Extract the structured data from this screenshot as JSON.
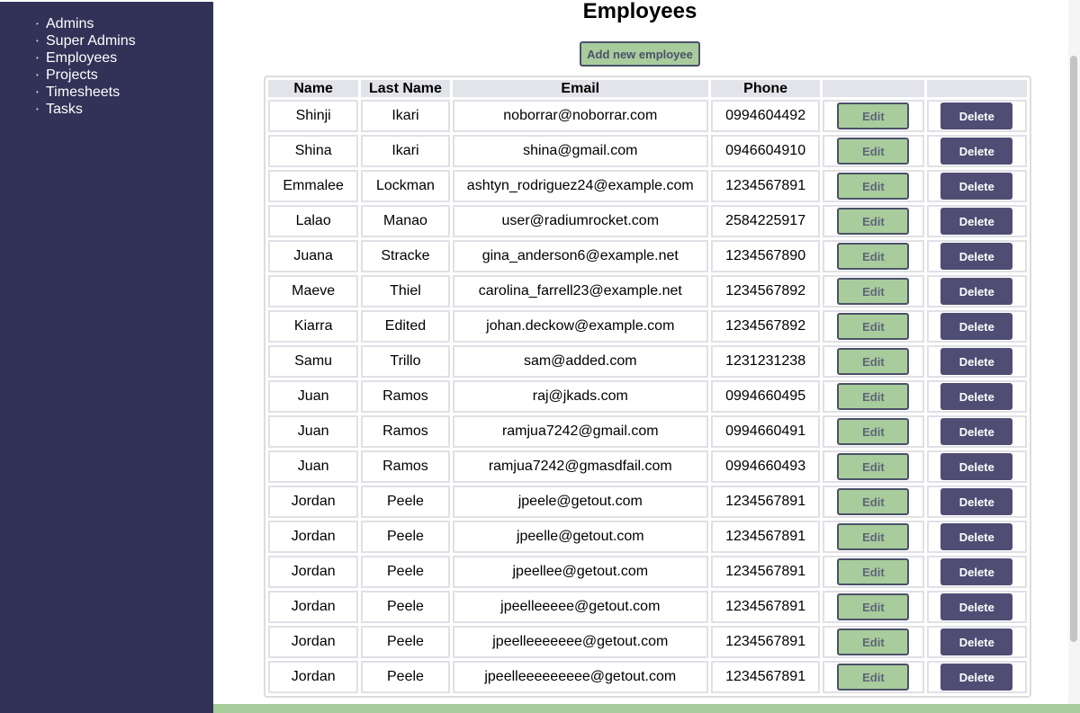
{
  "sidebar": {
    "items": [
      {
        "label": "Admins"
      },
      {
        "label": "Super Admins"
      },
      {
        "label": "Employees"
      },
      {
        "label": "Projects"
      },
      {
        "label": "Timesheets"
      },
      {
        "label": "Tasks"
      }
    ]
  },
  "main": {
    "title": "Employees",
    "add_label": "Add new employee"
  },
  "table": {
    "headers": {
      "name": "Name",
      "last_name": "Last Name",
      "email": "Email",
      "phone": "Phone"
    },
    "edit_label": "Edit",
    "delete_label": "Delete",
    "rows": [
      {
        "name": "Shinji",
        "last_name": "Ikari",
        "email": "noborrar@noborrar.com",
        "phone": "0994604492"
      },
      {
        "name": "Shina",
        "last_name": "Ikari",
        "email": "shina@gmail.com",
        "phone": "0946604910"
      },
      {
        "name": "Emmalee",
        "last_name": "Lockman",
        "email": "ashtyn_rodriguez24@example.com",
        "phone": "1234567891"
      },
      {
        "name": "Lalao",
        "last_name": "Manao",
        "email": "user@radiumrocket.com",
        "phone": "2584225917"
      },
      {
        "name": "Juana",
        "last_name": "Stracke",
        "email": "gina_anderson6@example.net",
        "phone": "1234567890"
      },
      {
        "name": "Maeve",
        "last_name": "Thiel",
        "email": "carolina_farrell23@example.net",
        "phone": "1234567892"
      },
      {
        "name": "Kiarra",
        "last_name": "Edited",
        "email": "johan.deckow@example.com",
        "phone": "1234567892"
      },
      {
        "name": "Samu",
        "last_name": "Trillo",
        "email": "sam@added.com",
        "phone": "1231231238"
      },
      {
        "name": "Juan",
        "last_name": "Ramos",
        "email": "raj@jkads.com",
        "phone": "0994660495"
      },
      {
        "name": "Juan",
        "last_name": "Ramos",
        "email": "ramjua7242@gmail.com",
        "phone": "0994660491"
      },
      {
        "name": "Juan",
        "last_name": "Ramos",
        "email": "ramjua7242@gmasdfail.com",
        "phone": "0994660493"
      },
      {
        "name": "Jordan",
        "last_name": "Peele",
        "email": "jpeele@getout.com",
        "phone": "1234567891"
      },
      {
        "name": "Jordan",
        "last_name": "Peele",
        "email": "jpeelle@getout.com",
        "phone": "1234567891"
      },
      {
        "name": "Jordan",
        "last_name": "Peele",
        "email": "jpeellee@getout.com",
        "phone": "1234567891"
      },
      {
        "name": "Jordan",
        "last_name": "Peele",
        "email": "jpeelleeeee@getout.com",
        "phone": "1234567891"
      },
      {
        "name": "Jordan",
        "last_name": "Peele",
        "email": "jpeelleeeeeee@getout.com",
        "phone": "1234567891"
      },
      {
        "name": "Jordan",
        "last_name": "Peele",
        "email": "jpeelleeeeeeeee@getout.com",
        "phone": "1234567891"
      }
    ]
  }
}
